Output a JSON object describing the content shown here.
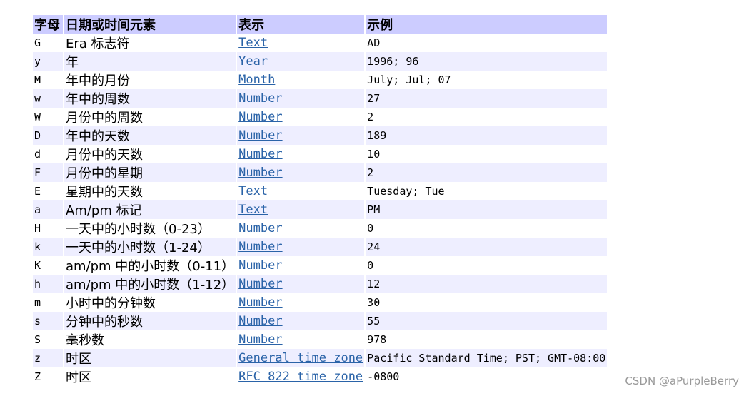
{
  "colors": {
    "header_bg": "#ccccff",
    "stripe_bg": "#eeeeff",
    "plain_bg": "#ffffff",
    "link": "#2a63a8",
    "watermark": "#999999"
  },
  "table": {
    "headers": {
      "letter": "字母",
      "element": "日期或时间元素",
      "presentation": "表示",
      "example": "示例"
    },
    "rows": [
      {
        "letter": "G",
        "element": "Era 标志符",
        "presentation": "Text",
        "example": "AD"
      },
      {
        "letter": "y",
        "element": "年",
        "presentation": "Year",
        "example": "1996; 96"
      },
      {
        "letter": "M",
        "element": "年中的月份",
        "presentation": "Month",
        "example": "July; Jul; 07"
      },
      {
        "letter": "w",
        "element": "年中的周数",
        "presentation": "Number",
        "example": "27"
      },
      {
        "letter": "W",
        "element": "月份中的周数",
        "presentation": "Number",
        "example": "2"
      },
      {
        "letter": "D",
        "element": "年中的天数",
        "presentation": "Number",
        "example": "189"
      },
      {
        "letter": "d",
        "element": "月份中的天数",
        "presentation": "Number",
        "example": "10"
      },
      {
        "letter": "F",
        "element": "月份中的星期",
        "presentation": "Number",
        "example": "2"
      },
      {
        "letter": "E",
        "element": "星期中的天数",
        "presentation": "Text",
        "example": "Tuesday; Tue"
      },
      {
        "letter": "a",
        "element": "Am/pm 标记",
        "presentation": "Text",
        "example": "PM"
      },
      {
        "letter": "H",
        "element": "一天中的小时数（0-23）",
        "presentation": "Number",
        "example": "0"
      },
      {
        "letter": "k",
        "element": "一天中的小时数（1-24）",
        "presentation": "Number",
        "example": "24"
      },
      {
        "letter": "K",
        "element": "am/pm 中的小时数（0-11）",
        "presentation": "Number",
        "example": "0"
      },
      {
        "letter": "h",
        "element": "am/pm 中的小时数（1-12）",
        "presentation": "Number",
        "example": "12"
      },
      {
        "letter": "m",
        "element": "小时中的分钟数",
        "presentation": "Number",
        "example": "30"
      },
      {
        "letter": "s",
        "element": "分钟中的秒数",
        "presentation": "Number",
        "example": "55"
      },
      {
        "letter": "S",
        "element": "毫秒数",
        "presentation": "Number",
        "example": "978"
      },
      {
        "letter": "z",
        "element": "时区",
        "presentation": "General time zone",
        "example": "Pacific Standard Time; PST; GMT-08:00"
      },
      {
        "letter": "Z",
        "element": "时区",
        "presentation": "RFC 822 time zone",
        "example": "-0800"
      }
    ]
  },
  "watermark": "CSDN @aPurpleBerry"
}
